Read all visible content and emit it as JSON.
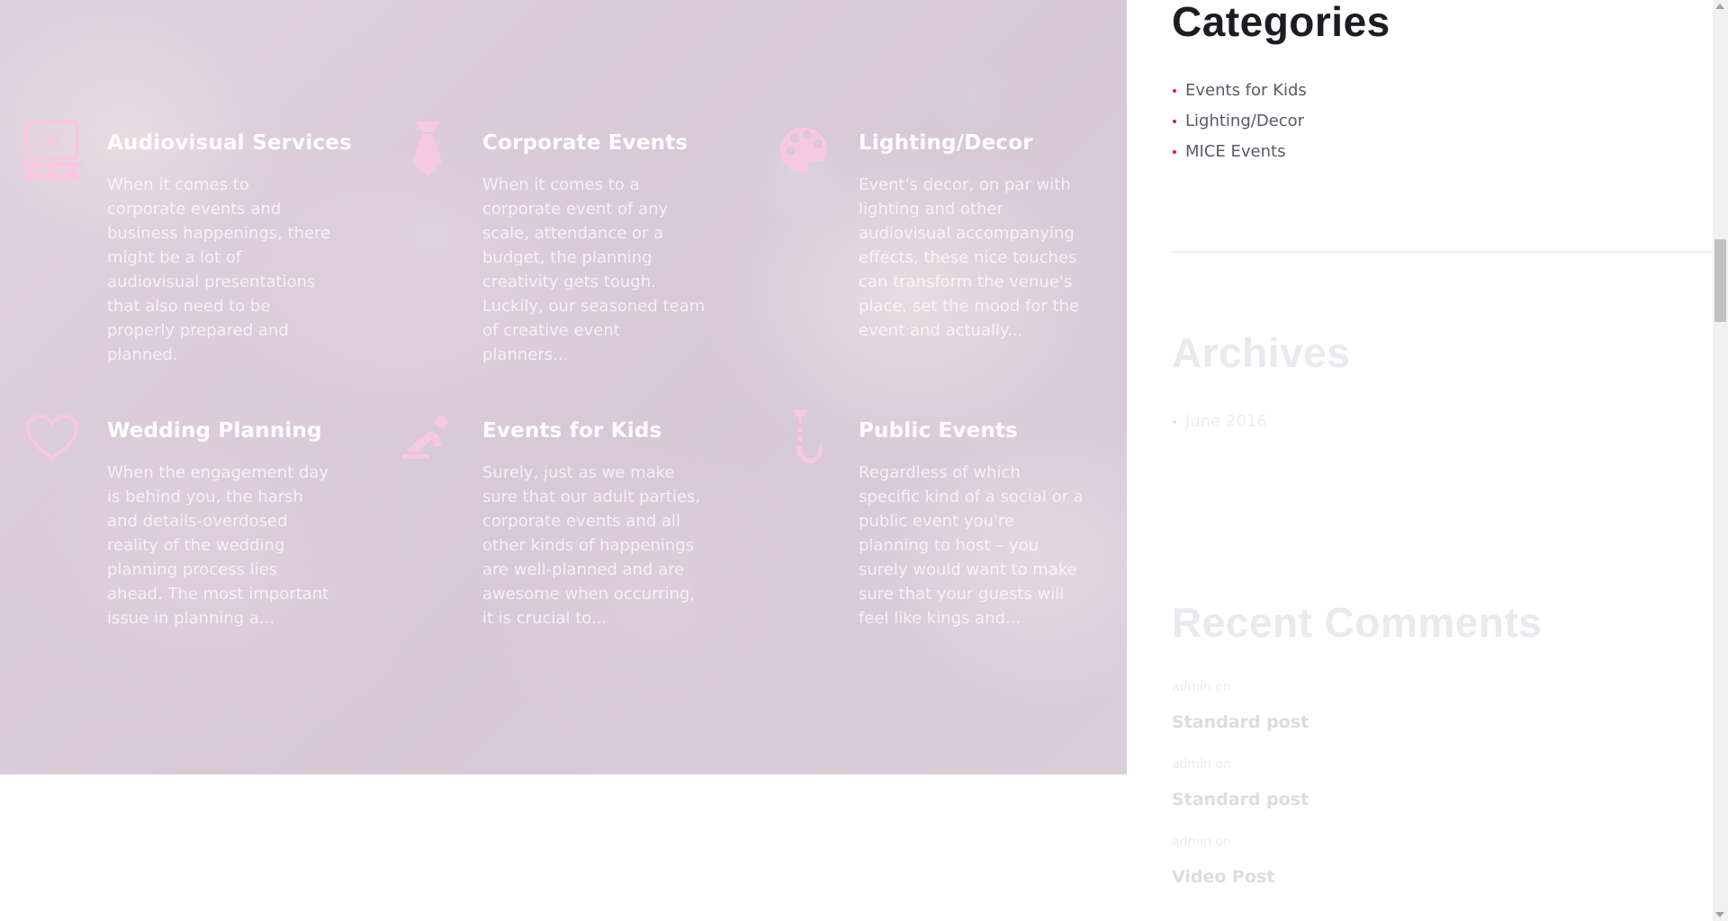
{
  "services": [
    {
      "icon": "presentation-screen-icon",
      "title": "Audiovisual Services",
      "text": "When it comes to corporate events and business happenings, there might be a lot of audiovisual presentations that also need to be properly prepared and planned."
    },
    {
      "icon": "necktie-icon",
      "title": "Corporate Events",
      "text": "When it comes to a corporate event of any scale, attendance or a budget, the planning creativity gets tough. Luckily, our seasoned team of creative event planners..."
    },
    {
      "icon": "paint-palette-icon",
      "title": "Lighting/Decor",
      "text": "Event's decor, on par with lighting and other audiovisual accompanying effects, these nice touches can transform the venue's place, set the mood for the event and actually..."
    },
    {
      "icon": "heart-icon",
      "title": "Wedding Planning",
      "text": "When the engagement day is behind you, the harsh and details-overdosed reality of the wedding planning process lies ahead. The most important issue in planning a..."
    },
    {
      "icon": "child-slide-icon",
      "title": "Events for Kids",
      "text": "Surely, just as we make sure that our adult parties, corporate events and all other kinds of happenings are well-planned and are awesome when occurring, it is crucial to..."
    },
    {
      "icon": "saxophone-icon",
      "title": "Public Events",
      "text": "Regardless of which specific kind of a social or a public event you're planning to host – you surely would want to make sure that your guests will feel like kings and..."
    }
  ],
  "sidebar": {
    "categories": {
      "title": "Categories",
      "items": [
        "Events for Kids",
        "Lighting/Decor",
        "MICE Events"
      ]
    },
    "archives": {
      "title": "Archives",
      "items": [
        "June 2016"
      ]
    },
    "recent_comments": {
      "title": "Recent Comments",
      "items": [
        {
          "meta": "admin on",
          "post": "Standard post"
        },
        {
          "meta": "admin on",
          "post": "Standard post"
        },
        {
          "meta": "admin on",
          "post": "Video Post"
        }
      ]
    }
  },
  "colors": {
    "accent": "#e0107a",
    "icon_pink": "#f7c9df",
    "title_dark": "#1c1c22"
  }
}
